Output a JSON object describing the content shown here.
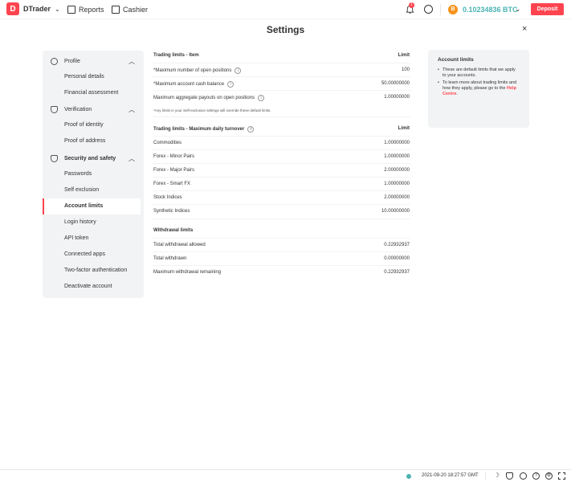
{
  "header": {
    "brand": "DTrader",
    "nav": [
      {
        "label": "Reports"
      },
      {
        "label": "Cashier"
      }
    ],
    "notification_count": "1",
    "currency_symbol": "B",
    "balance": "0.10234836 BTC",
    "deposit_label": "Deposit"
  },
  "page": {
    "title": "Settings",
    "close_icon": "×"
  },
  "sidebar": {
    "sections": [
      {
        "label": "Profile",
        "icon": "user-icon",
        "items": [
          "Personal details",
          "Financial assessment"
        ]
      },
      {
        "label": "Verification",
        "icon": "shield-check-icon",
        "items": [
          "Proof of identity",
          "Proof of address"
        ]
      },
      {
        "label": "Security and safety",
        "icon": "lock-shield-icon",
        "items": [
          "Passwords",
          "Self exclusion",
          "Account limits",
          "Login history",
          "API token",
          "Connected apps",
          "Two-factor authentication",
          "Deactivate account"
        ]
      }
    ],
    "active_item": "Account limits"
  },
  "limits": {
    "item": {
      "title": "Trading limits - Item",
      "col": "Limit",
      "rows": [
        {
          "label": "*Maximum number of open positions",
          "value": "100"
        },
        {
          "label": "*Maximum account cash balance",
          "value": "50.00000000"
        },
        {
          "label": "Maximum aggregate payouts on open positions",
          "value": "1.00000000"
        }
      ],
      "note": "*Any limits in your Self-exclusion settings will override these default limits."
    },
    "turnover": {
      "title": "Trading limits - Maximum daily turnover",
      "col": "Limit",
      "rows": [
        {
          "label": "Commodities",
          "value": "1.00000000"
        },
        {
          "label": "Forex - Minor Pairs",
          "value": "1.00000000"
        },
        {
          "label": "Forex - Major Pairs",
          "value": "2.00000000"
        },
        {
          "label": "Forex - Smart FX",
          "value": "1.00000000"
        },
        {
          "label": "Stock Indices",
          "value": "2.00000000"
        },
        {
          "label": "Synthetic Indices",
          "value": "10.00000000"
        }
      ]
    },
    "withdrawal": {
      "title": "Withdrawal limits",
      "rows": [
        {
          "label": "Total withdrawal allowed",
          "value": "0.22932937"
        },
        {
          "label": "Total withdrawn",
          "value": "0.00000000"
        },
        {
          "label": "Maximum withdrawal remaining",
          "value": "0.22932937"
        }
      ]
    }
  },
  "infobox": {
    "title": "Account limits",
    "bullet1": "These are default limits that we apply to your accounts.",
    "bullet2_pre": "To learn more about trading limits and how they apply, please go to the ",
    "bullet2_link": "Help Centre",
    "bullet2_post": "."
  },
  "footer": {
    "time": "2021-09-20 18:27:57 GMT"
  },
  "colors": {
    "brand": "#ff444f",
    "balance": "#4bb4b3",
    "panel": "#f2f3f4"
  }
}
